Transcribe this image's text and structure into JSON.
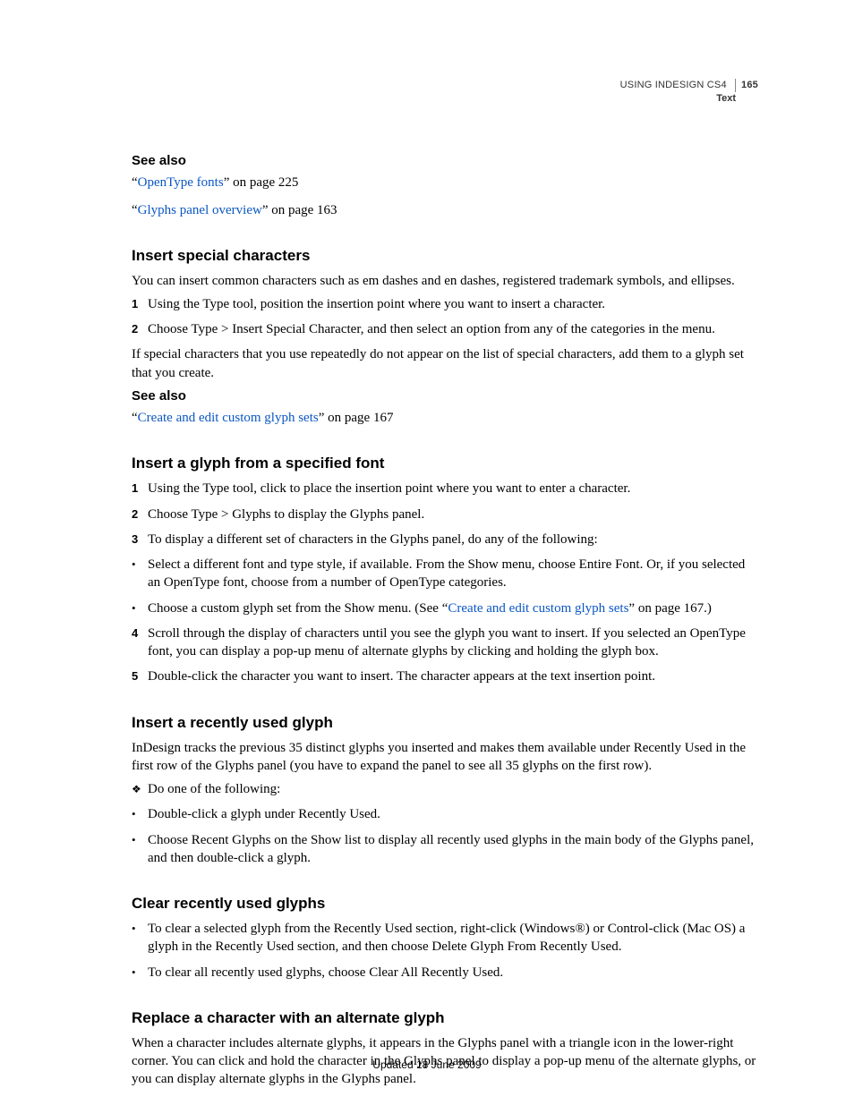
{
  "header": {
    "doc_title": "USING INDESIGN CS4",
    "chapter": "Text",
    "page_number": "165"
  },
  "see_also_1": {
    "heading": "See also",
    "refs": [
      {
        "q1": "“",
        "link": "OpenType fonts",
        "tail": "” on page 225"
      },
      {
        "q1": "“",
        "link": "Glyphs panel overview",
        "tail": "” on page 163"
      }
    ]
  },
  "section_insert_special": {
    "heading": "Insert special characters",
    "intro": "You can insert common characters such as em dashes and en dashes, registered trademark symbols, and ellipses.",
    "steps": [
      "Using the Type tool, position the insertion point where you want to insert a character.",
      "Choose Type > Insert Special Character, and then select an option from any of the categories in the menu."
    ],
    "after": "If special characters that you use repeatedly do not appear on the list of special characters, add them to a glyph set that you create."
  },
  "see_also_2": {
    "heading": "See also",
    "refs": [
      {
        "q1": "“",
        "link": "Create and edit custom glyph sets",
        "tail": "” on page 167"
      }
    ]
  },
  "section_insert_font": {
    "heading": "Insert a glyph from a specified font",
    "steps_1_2_3": [
      "Using the Type tool, click to place the insertion point where you want to enter a character.",
      "Choose Type > Glyphs to display the Glyphs panel.",
      "To display a different set of characters in the Glyphs panel, do any of the following:"
    ],
    "sub_bullets": {
      "b1": "Select a different font and type style, if available. From the Show menu, choose Entire Font. Or, if you selected an OpenType font, choose from a number of OpenType categories.",
      "b2_pre": "Choose a custom glyph set from the Show menu. (See “",
      "b2_link": "Create and edit custom glyph sets",
      "b2_post": "” on page 167.)"
    },
    "steps_4_5": [
      "Scroll through the display of characters until you see the glyph you want to insert. If you selected an OpenType font, you can display a pop-up menu of alternate glyphs by clicking and holding the glyph box.",
      "Double-click the character you want to insert. The character appears at the text insertion point."
    ]
  },
  "section_recent": {
    "heading": "Insert a recently used glyph",
    "intro": "InDesign tracks the previous 35 distinct glyphs you inserted and makes them available under Recently Used in the first row of the Glyphs panel (you have to expand the panel to see all 35 glyphs on the first row).",
    "diamond": "Do one of the following:",
    "bullets": [
      "Double-click a glyph under Recently Used.",
      "Choose Recent Glyphs on the Show list to display all recently used glyphs in the main body of the Glyphs panel, and then double-click a glyph."
    ]
  },
  "section_clear": {
    "heading": "Clear recently used glyphs",
    "bullets": [
      "To clear a selected glyph from the Recently Used section, right-click (Windows®) or Control-click (Mac OS) a glyph in the Recently Used section, and then choose Delete Glyph From Recently Used.",
      "To clear all recently used glyphs, choose Clear All Recently Used."
    ]
  },
  "section_replace": {
    "heading": "Replace a character with an alternate glyph",
    "body": "When a character includes alternate glyphs, it appears in the Glyphs panel with a triangle icon in the lower-right corner. You can click and hold the character in the Glyphs panel to display a pop-up menu of the alternate glyphs, or you can display alternate glyphs in the Glyphs panel."
  },
  "footer": "Updated 18 June 2009"
}
